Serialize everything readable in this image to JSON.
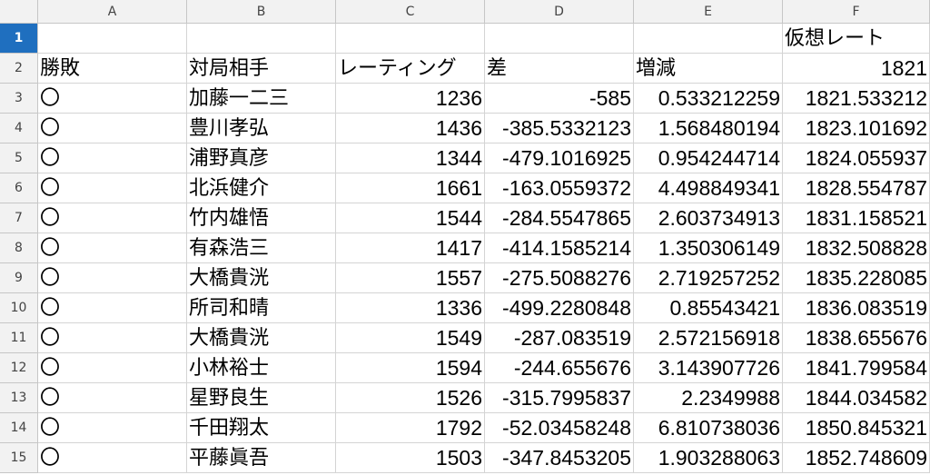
{
  "columns": [
    "A",
    "B",
    "C",
    "D",
    "E",
    "F"
  ],
  "rows": [
    {
      "n": "1",
      "a": "",
      "b": "",
      "c": "",
      "d": "",
      "e": "",
      "f": "仮想レート"
    },
    {
      "n": "2",
      "a": "勝敗",
      "b": "対局相手",
      "c": "レーティング",
      "d": "差",
      "e": "増減",
      "f": "1821"
    },
    {
      "n": "3",
      "a": "〇",
      "b": "加藤一二三",
      "c": "1236",
      "d": "-585",
      "e": "0.533212259",
      "f": "1821.533212"
    },
    {
      "n": "4",
      "a": "〇",
      "b": "豊川孝弘",
      "c": "1436",
      "d": "-385.5332123",
      "e": "1.568480194",
      "f": "1823.101692"
    },
    {
      "n": "5",
      "a": "〇",
      "b": "浦野真彦",
      "c": "1344",
      "d": "-479.1016925",
      "e": "0.954244714",
      "f": "1824.055937"
    },
    {
      "n": "6",
      "a": "〇",
      "b": "北浜健介",
      "c": "1661",
      "d": "-163.0559372",
      "e": "4.498849341",
      "f": "1828.554787"
    },
    {
      "n": "7",
      "a": "〇",
      "b": "竹内雄悟",
      "c": "1544",
      "d": "-284.5547865",
      "e": "2.603734913",
      "f": "1831.158521"
    },
    {
      "n": "8",
      "a": "〇",
      "b": "有森浩三",
      "c": "1417",
      "d": "-414.1585214",
      "e": "1.350306149",
      "f": "1832.508828"
    },
    {
      "n": "9",
      "a": "〇",
      "b": "大橋貴洸",
      "c": "1557",
      "d": "-275.5088276",
      "e": "2.719257252",
      "f": "1835.228085"
    },
    {
      "n": "10",
      "a": "〇",
      "b": "所司和晴",
      "c": "1336",
      "d": "-499.2280848",
      "e": "0.85543421",
      "f": "1836.083519"
    },
    {
      "n": "11",
      "a": "〇",
      "b": "大橋貴洸",
      "c": "1549",
      "d": "-287.083519",
      "e": "2.572156918",
      "f": "1838.655676"
    },
    {
      "n": "12",
      "a": "〇",
      "b": "小林裕士",
      "c": "1594",
      "d": "-244.655676",
      "e": "3.143907726",
      "f": "1841.799584"
    },
    {
      "n": "13",
      "a": "〇",
      "b": "星野良生",
      "c": "1526",
      "d": "-315.7995837",
      "e": "2.2349988",
      "f": "1844.034582"
    },
    {
      "n": "14",
      "a": "〇",
      "b": "千田翔太",
      "c": "1792",
      "d": "-52.03458248",
      "e": "6.810738036",
      "f": "1850.845321"
    },
    {
      "n": "15",
      "a": "〇",
      "b": "平藤眞吾",
      "c": "1503",
      "d": "-347.8453205",
      "e": "1.903288063",
      "f": "1852.748609"
    }
  ],
  "active_row": "1"
}
